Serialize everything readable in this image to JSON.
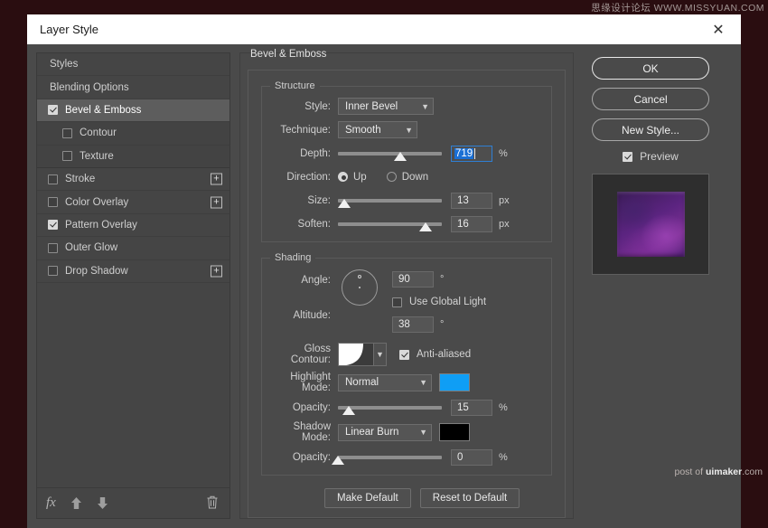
{
  "watermarks": {
    "top_right": "思缘设计论坛 WWW.MISSYUAN.COM",
    "bottom_prefix": "post of ",
    "bottom_brand": "uimaker",
    "bottom_suffix": ".com"
  },
  "window": {
    "title": "Layer Style",
    "close_icon": "✕"
  },
  "styles_panel": {
    "items": [
      {
        "label": "Styles",
        "type": "plain",
        "checked": null,
        "plus": false
      },
      {
        "label": "Blending Options",
        "type": "plain",
        "checked": null,
        "plus": false
      },
      {
        "label": "Bevel & Emboss",
        "type": "selected",
        "checked": true,
        "plus": false
      },
      {
        "label": "Contour",
        "type": "subitem",
        "checked": false,
        "plus": false
      },
      {
        "label": "Texture",
        "type": "subitem",
        "checked": false,
        "plus": false
      },
      {
        "label": "Stroke",
        "type": "normal",
        "checked": false,
        "plus": true
      },
      {
        "label": "Color Overlay",
        "type": "normal",
        "checked": false,
        "plus": true
      },
      {
        "label": "Pattern Overlay",
        "type": "normal",
        "checked": true,
        "plus": false
      },
      {
        "label": "Outer Glow",
        "type": "normal",
        "checked": false,
        "plus": false
      },
      {
        "label": "Drop Shadow",
        "type": "normal",
        "checked": false,
        "plus": true
      }
    ],
    "footer": {
      "fx_label": "fx",
      "move_up_icon": "move-up-arrow-icon",
      "move_down_icon": "move-down-arrow-icon",
      "delete_icon": "trash-icon",
      "plus_label": "+"
    }
  },
  "effect": {
    "title": "Bevel & Emboss",
    "structure": {
      "legend": "Structure",
      "style_label": "Style:",
      "style_value": "Inner Bevel",
      "technique_label": "Technique:",
      "technique_value": "Smooth",
      "depth_label": "Depth:",
      "depth_value": "719",
      "depth_unit": "%",
      "depth_slider_pct": 60,
      "direction_label": "Direction:",
      "direction_up": "Up",
      "direction_down": "Down",
      "direction_selected": "Up",
      "size_label": "Size:",
      "size_value": "13",
      "size_unit": "px",
      "size_slider_pct": 6,
      "soften_label": "Soften:",
      "soften_value": "16",
      "soften_unit": "px",
      "soften_slider_pct": 84
    },
    "shading": {
      "legend": "Shading",
      "angle_label": "Angle:",
      "angle_value": "90",
      "angle_unit": "°",
      "use_global_light": "Use Global Light",
      "use_global_light_checked": false,
      "altitude_label": "Altitude:",
      "altitude_value": "38",
      "altitude_unit": "°",
      "gloss_contour_label": "Gloss Contour:",
      "anti_aliased": "Anti-aliased",
      "anti_aliased_checked": true,
      "highlight_mode_label": "Highlight Mode:",
      "highlight_mode_value": "Normal",
      "highlight_color": "#0f9ef5",
      "highlight_opacity_label": "Opacity:",
      "highlight_opacity_value": "15",
      "highlight_opacity_unit": "%",
      "highlight_opacity_pct": 10,
      "shadow_mode_label": "Shadow Mode:",
      "shadow_mode_value": "Linear Burn",
      "shadow_color": "#000000",
      "shadow_opacity_label": "Opacity:",
      "shadow_opacity_value": "0",
      "shadow_opacity_unit": "%",
      "shadow_opacity_pct": 0
    },
    "make_default": "Make Default",
    "reset_to_default": "Reset to Default"
  },
  "actions": {
    "ok": "OK",
    "cancel": "Cancel",
    "new_style": "New Style...",
    "preview": "Preview",
    "preview_checked": true
  }
}
